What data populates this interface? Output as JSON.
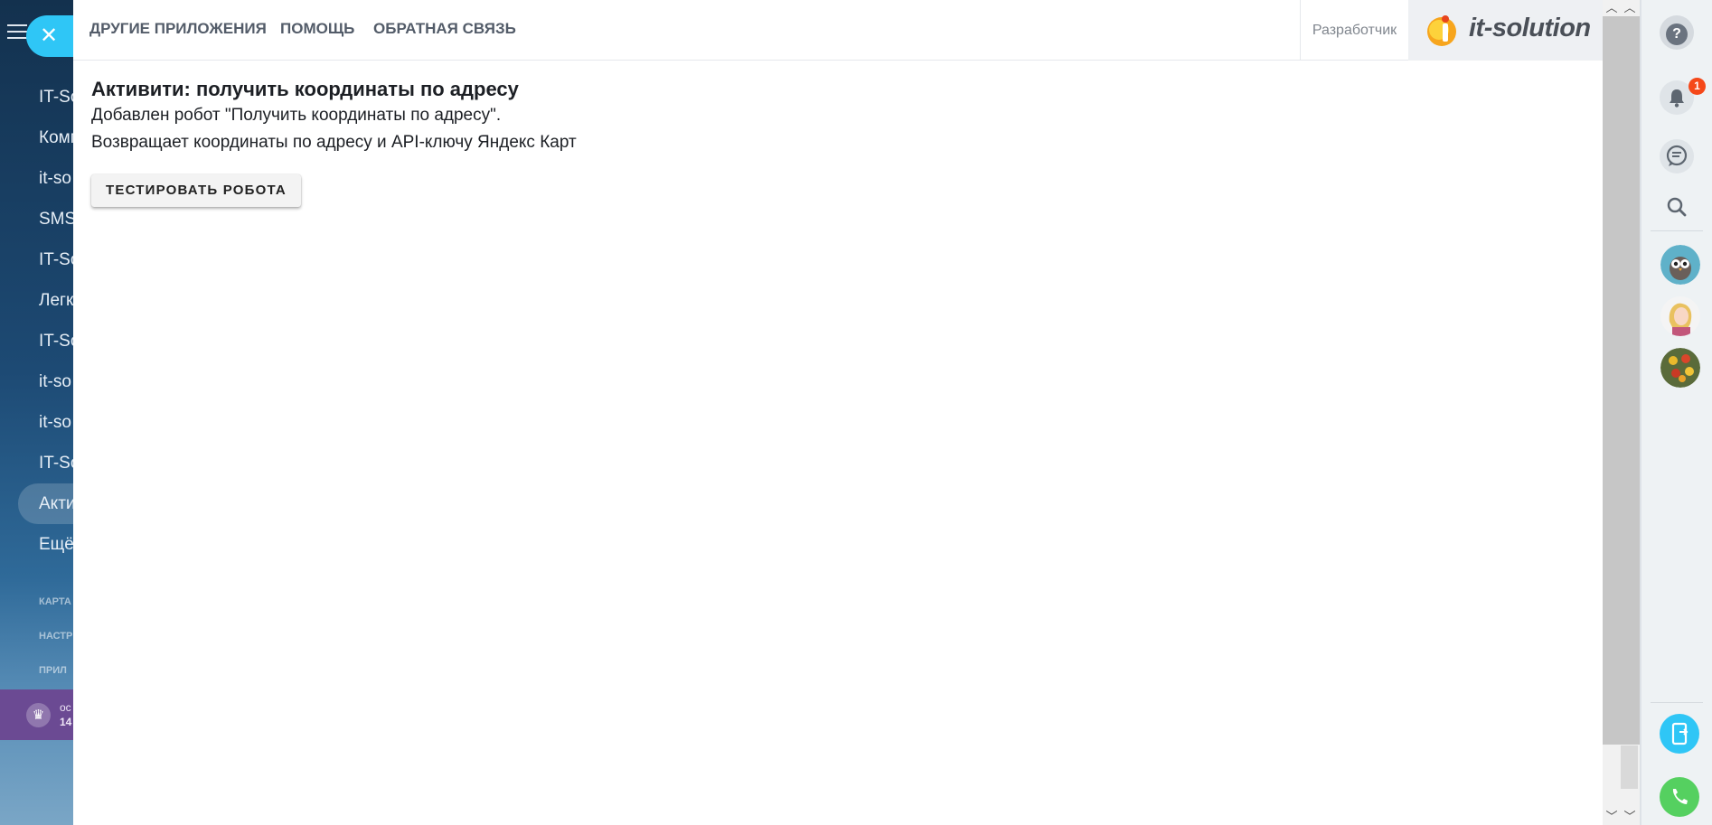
{
  "portal_sidebar": {
    "items": [
      "IT-So",
      "Комп",
      "it-so",
      "SMS",
      "IT-So",
      "Легк",
      "IT-So",
      "it-so",
      "it-so",
      "IT-So",
      "Акти",
      "Ещё"
    ],
    "sections": [
      "КАРТА",
      "НАСТР",
      "ПРИЛ"
    ],
    "plan_line1": "ос",
    "plan_line2": "14"
  },
  "topnav": {
    "other_apps": "ДРУГИЕ ПРИЛОЖЕНИЯ",
    "help": "ПОМОЩЬ",
    "feedback": "ОБРАТНАЯ СВЯЗЬ",
    "developer": "Разработчик",
    "logo_text": "it-solution"
  },
  "content": {
    "title": "Активити: получить координаты по адресу",
    "line1": "Добавлен робот \"Получить координаты по адресу\".",
    "line2": "Возвращает координаты по адресу и API-ключу Яндекс Карт",
    "test_button": "ТЕСТИРОВАТЬ РОБОТА"
  },
  "right_panel": {
    "help_glyph": "?",
    "notifications_count": "1"
  },
  "colors": {
    "accent": "#2fc6f6",
    "badge": "#f54819",
    "logo_orange": "#f7a51d",
    "plan_purple": "#6b4a93"
  },
  "icons": [
    "burger-menu-icon",
    "close-icon",
    "crown-icon",
    "help-icon",
    "bell-icon",
    "chat-icon",
    "search-icon",
    "avatar-owl",
    "avatar-woman",
    "avatar-flowers",
    "mobile-sync-icon",
    "phone-icon"
  ]
}
